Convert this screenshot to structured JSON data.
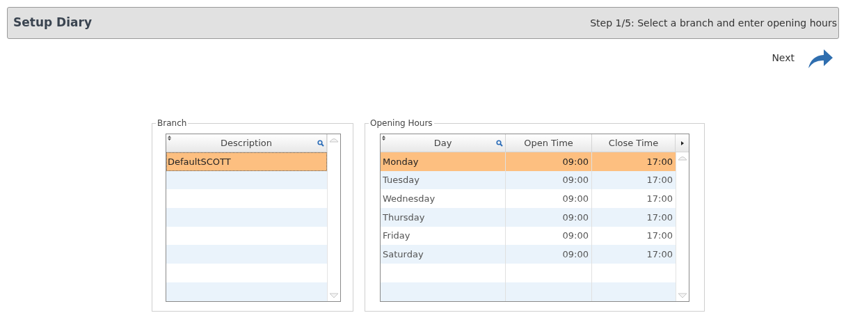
{
  "header": {
    "title": "Setup Diary",
    "step": "Step 1/5: Select a branch and enter opening hours"
  },
  "next_button": {
    "label": "Next"
  },
  "branch": {
    "legend": "Branch",
    "columns": [
      "Description"
    ],
    "rows": [
      {
        "description": "DefaultSCOTT",
        "selected": true
      }
    ]
  },
  "opening_hours": {
    "legend": "Opening Hours",
    "columns": [
      "Day",
      "Open Time",
      "Close Time"
    ],
    "rows": [
      {
        "day": "Monday",
        "open": "09:00",
        "close": "17:00",
        "selected": true
      },
      {
        "day": "Tuesday",
        "open": "09:00",
        "close": "17:00",
        "selected": false
      },
      {
        "day": "Wednesday",
        "open": "09:00",
        "close": "17:00",
        "selected": false
      },
      {
        "day": "Thursday",
        "open": "09:00",
        "close": "17:00",
        "selected": false
      },
      {
        "day": "Friday",
        "open": "09:00",
        "close": "17:00",
        "selected": false
      },
      {
        "day": "Saturday",
        "open": "09:00",
        "close": "17:00",
        "selected": false
      }
    ]
  }
}
